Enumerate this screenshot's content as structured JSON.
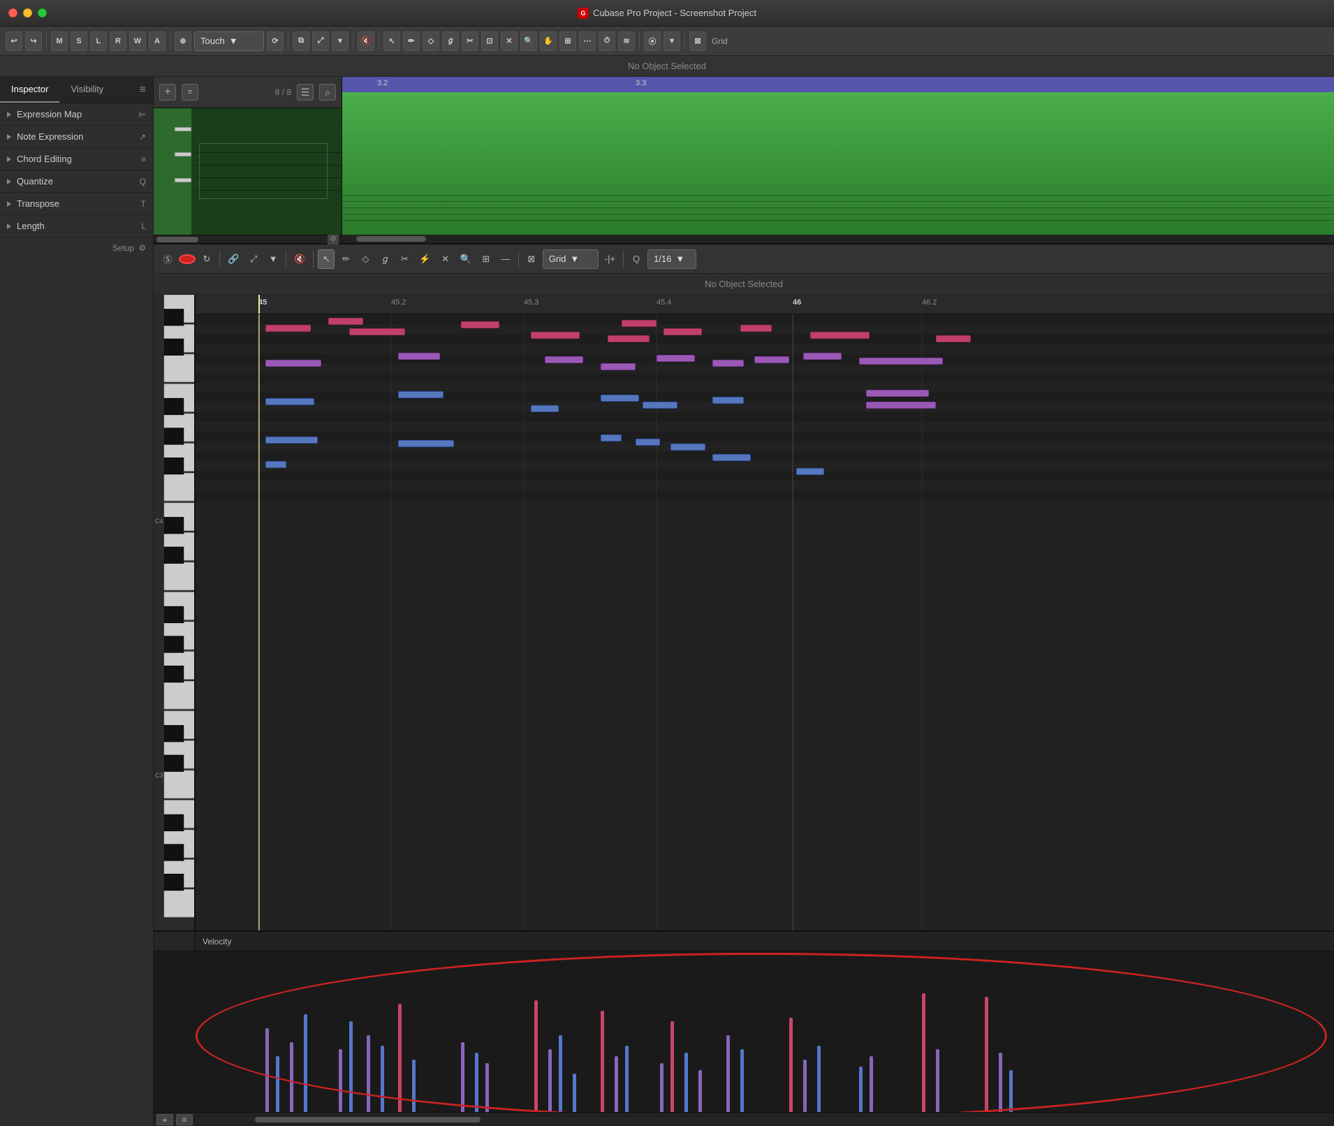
{
  "window": {
    "title": "Cubase Pro Project - Screenshot Project"
  },
  "titlebar": {
    "title": "Cubase Pro Project - Screenshot Project",
    "icon_label": "G"
  },
  "toolbar": {
    "undo_label": "↩",
    "redo_label": "↪",
    "m_label": "M",
    "s_label": "S",
    "l_label": "L",
    "r_label": "R",
    "w_label": "W",
    "a_label": "A",
    "touch_label": "Touch",
    "grid_label": "Grid",
    "no_object_selected": "No Object Selected"
  },
  "inspector": {
    "title": "Inspector",
    "visibility_tab": "Visibility",
    "items": [
      {
        "label": "Expression Map",
        "icon": "⊨"
      },
      {
        "label": "Note Expression",
        "icon": "↗"
      },
      {
        "label": "Chord Editing",
        "icon": "≡"
      },
      {
        "label": "Quantize",
        "icon": "Q"
      },
      {
        "label": "Transpose",
        "icon": "T"
      },
      {
        "label": "Length",
        "icon": "L"
      }
    ],
    "setup_label": "Setup"
  },
  "arrangement": {
    "track_count": "8 / 8",
    "ruler_marks": [
      "3.2",
      "3.3"
    ]
  },
  "piano_roll": {
    "no_object_selected": "No Object Selected",
    "grid_label": "Grid",
    "quantize_label": "1/16",
    "ruler_marks": [
      "45",
      "45.2",
      "45.3",
      "45.4",
      "46",
      "46.2"
    ],
    "playhead_position": "45",
    "c4_label": "C4",
    "c3_label": "C3",
    "velocity_label": "Velocity"
  },
  "colors": {
    "accent_green": "#4aae4a",
    "accent_purple": "#7070cc",
    "note_pink": "#c0406a",
    "note_purple": "#9b59b6",
    "note_blue": "#5577bb",
    "annotation_red": "#cc2222"
  }
}
